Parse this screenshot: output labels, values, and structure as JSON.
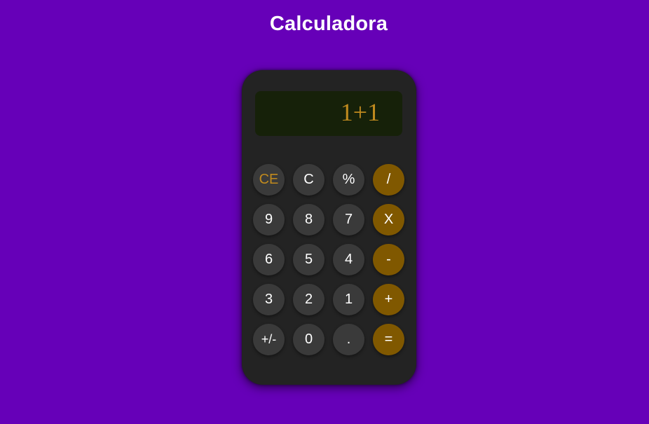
{
  "page": {
    "title": "Calculadora"
  },
  "display": {
    "value": "1+1"
  },
  "keys": {
    "ce": "CE",
    "c": "C",
    "percent": "%",
    "divide": "/",
    "nine": "9",
    "eight": "8",
    "seven": "7",
    "multiply": "X",
    "six": "6",
    "five": "5",
    "four": "4",
    "minus": "-",
    "three": "3",
    "two": "2",
    "one": "1",
    "plus": "+",
    "negate": "+/-",
    "zero": "0",
    "decimal": ".",
    "equals": "="
  },
  "colors": {
    "background": "#6600b8",
    "calculator_body": "#232323",
    "display_background": "#162109",
    "display_text": "#c08a1e",
    "key_background": "#3a3a3a",
    "operator_key_background": "#805800"
  }
}
